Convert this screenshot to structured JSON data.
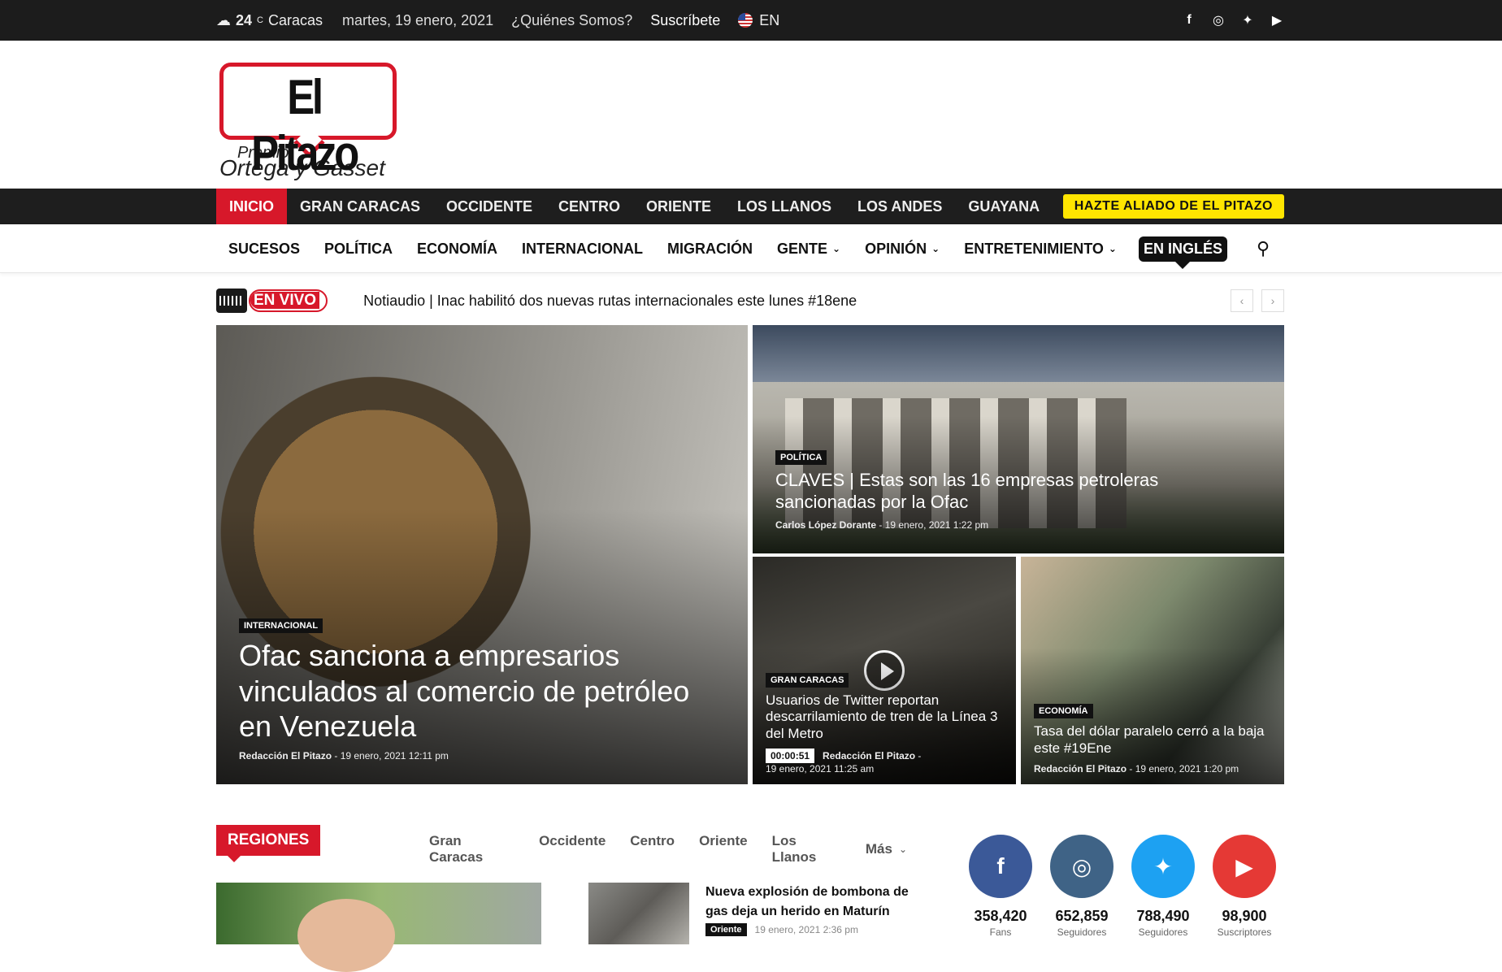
{
  "topbar": {
    "temp": "24",
    "temp_unit": "C",
    "city": "Caracas",
    "date": "martes, 19 enero, 2021",
    "about": "¿Quiénes Somos?",
    "subscribe": "Suscríbete",
    "lang": "EN",
    "social_icons": [
      "facebook-icon",
      "instagram-icon",
      "twitter-icon",
      "youtube-icon"
    ]
  },
  "logo": {
    "name": "El Pitazo",
    "premio": "Premio",
    "prize": "Ortega y Gasset",
    "color": "#d7182a"
  },
  "regions_nav": {
    "items": [
      "INICIO",
      "GRAN CARACAS",
      "OCCIDENTE",
      "CENTRO",
      "ORIENTE",
      "LOS LLANOS",
      "LOS ANDES",
      "GUAYANA"
    ],
    "cta": "HAZTE ALIADO DE EL PITAZO"
  },
  "categories_nav": {
    "items": [
      "SUCESOS",
      "POLÍTICA",
      "ECONOMÍA",
      "INTERNACIONAL",
      "MIGRACIÓN",
      "GENTE",
      "OPINIÓN",
      "ENTRETENIMIENTO"
    ],
    "english": "EN INGLÉS"
  },
  "live": {
    "label": "EN VIVO",
    "headline": "Notiaudio | Inac habilitó dos nuevas rutas internacionales este lunes #18ene"
  },
  "featured": [
    {
      "tag": "INTERNACIONAL",
      "title": "Ofac sanciona a empresarios vinculados al comercio de petróleo en Venezuela",
      "author": "Redacción El Pitazo",
      "date": "19 enero, 2021 12:11 pm"
    },
    {
      "tag": "POLÍTICA",
      "title": "CLAVES | Estas son las 16 empresas petroleras sancionadas por la Ofac",
      "author": "Carlos López Dorante",
      "date": "19 enero, 2021 1:22 pm"
    },
    {
      "tag": "GRAN CARACAS",
      "title": "Usuarios de Twitter reportan descarrilamiento de tren de la Línea 3 del Metro",
      "duration": "00:00:51",
      "author": "Redacción El Pitazo",
      "date": "19 enero, 2021 11:25 am"
    },
    {
      "tag": "ECONOMÍA",
      "title": "Tasa del dólar paralelo cerró a la baja este #19Ene",
      "author": "Redacción El Pitazo",
      "date": "19 enero, 2021 1:20 pm"
    }
  ],
  "regiones": {
    "title": "REGIONES",
    "tabs": [
      "Gran Caracas",
      "Occidente",
      "Centro",
      "Oriente",
      "Los Llanos"
    ],
    "more": "Más",
    "article": {
      "title": "Nueva explosión de bombona de gas deja un herido en Maturín",
      "tag": "Oriente",
      "date": "19 enero, 2021 2:36 pm"
    }
  },
  "social_counters": [
    {
      "icon": "facebook-icon",
      "glyph": "f",
      "count": "358,420",
      "label": "Fans",
      "color": "#3b5998"
    },
    {
      "icon": "instagram-icon",
      "glyph": "◎",
      "count": "652,859",
      "label": "Seguidores",
      "color": "#3f6386"
    },
    {
      "icon": "twitter-icon",
      "glyph": "✦",
      "count": "788,490",
      "label": "Seguidores",
      "color": "#1da1f2"
    },
    {
      "icon": "youtube-icon",
      "glyph": "▶",
      "count": "98,900",
      "label": "Suscriptores",
      "color": "#e53935"
    }
  ]
}
